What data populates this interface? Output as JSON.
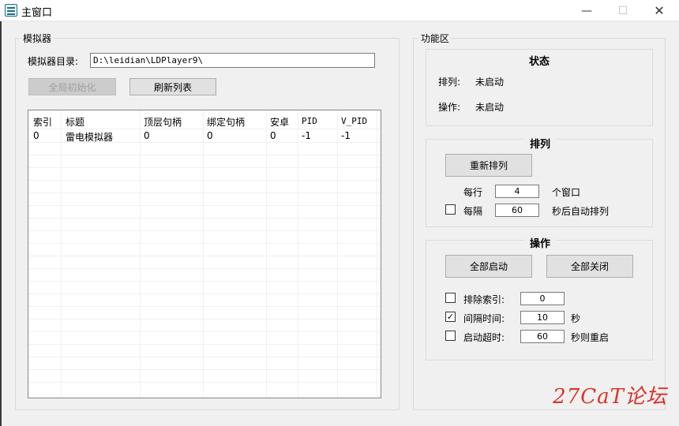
{
  "window": {
    "title": "主窗口",
    "min_glyph": "—",
    "max_glyph": "☐",
    "close_glyph": "✕"
  },
  "emulator": {
    "group_title": "模拟器",
    "dir_label": "模拟器目录:",
    "dir_value": "D:\\leidian\\LDPlayer9\\",
    "init_button": "全局初始化",
    "refresh_button": "刷新列表",
    "table": {
      "columns": [
        "索引",
        "标题",
        "顶层句柄",
        "绑定句柄",
        "安卓",
        "PID",
        "V_PID"
      ],
      "rows": [
        [
          "0",
          "雷电模拟器",
          "0",
          "0",
          "0",
          "-1",
          "-1"
        ]
      ]
    }
  },
  "function": {
    "group_title": "功能区",
    "status": {
      "title": "状态",
      "arrange_label": "排列:",
      "arrange_value": "未启动",
      "op_label": "操作:",
      "op_value": "未启动"
    },
    "arrange": {
      "title": "排列",
      "rearrange_button": "重新排列",
      "per_row_label": "每行",
      "per_row_value": "4",
      "per_row_unit": "个窗口",
      "interval_label": "每隔",
      "interval_value": "60",
      "interval_unit": "秒后自动排列",
      "interval_checked": false
    },
    "operate": {
      "title": "操作",
      "start_all_button": "全部启动",
      "close_all_button": "全部关闭",
      "exclude_label": "排除索引:",
      "exclude_value": "0",
      "exclude_checked": false,
      "gap_label": "间隔时间:",
      "gap_value": "10",
      "gap_unit": "秒",
      "gap_checked": true,
      "timeout_label": "启动超时:",
      "timeout_value": "60",
      "timeout_unit": "秒则重启",
      "timeout_checked": false
    }
  },
  "watermark": "27CaT论坛",
  "colors": {
    "accent": "#1c6f82",
    "watermark": "#d8342b"
  }
}
